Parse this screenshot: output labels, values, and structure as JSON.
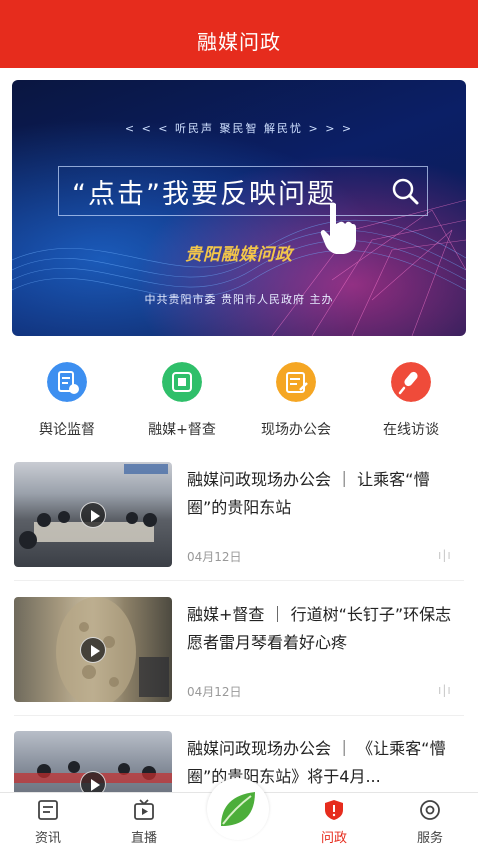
{
  "header": {
    "title": "融媒问政"
  },
  "banner": {
    "slogan": "< < < 听民声    聚民智    解民忧 > > >",
    "main_text": "“点击”我要反映问题",
    "logo_text": "贵阳融媒问政",
    "sponsor": "中共贵阳市委  贵阳市人民政府  主办"
  },
  "quick_entries": [
    {
      "label": "舆论监督",
      "icon": "document-icon",
      "color": "#3d8ff0"
    },
    {
      "label": "融媒+督查",
      "icon": "inspection-icon",
      "color": "#2fbf6a"
    },
    {
      "label": "现场办公会",
      "icon": "meeting-icon",
      "color": "#f5a623"
    },
    {
      "label": "在线访谈",
      "icon": "interview-icon",
      "color": "#ef4b3a"
    }
  ],
  "news": [
    {
      "title": "融媒问政现场办公会 ｜ 让乘客“懵圈”的贵阳东站",
      "date": "04月12日"
    },
    {
      "title": "融媒+督查 ｜ 行道树“长钉子”环保志愿者雷月琴看着好心疼",
      "date": "04月12日"
    },
    {
      "title": "融媒问政现场办公会 ｜ 《让乘客“懵圈”的贵阳东站》将于4月...",
      "date": ""
    }
  ],
  "tabbar": {
    "items": [
      {
        "label": "资讯",
        "icon": "news-icon"
      },
      {
        "label": "直播",
        "icon": "live-tv-icon"
      },
      {
        "label": "",
        "icon": "leaf-icon"
      },
      {
        "label": "问政",
        "icon": "shield-icon",
        "active": true
      },
      {
        "label": "服务",
        "icon": "service-icon"
      }
    ]
  },
  "colors": {
    "brand": "#e62c1d"
  }
}
